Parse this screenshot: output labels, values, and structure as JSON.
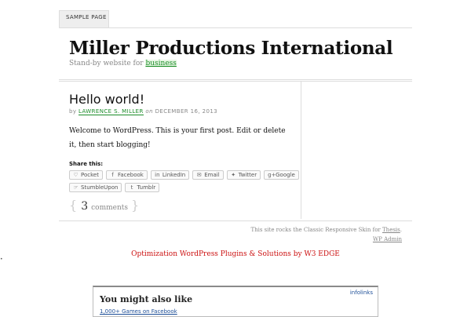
{
  "nav": {
    "sample_page": "Sample Page"
  },
  "header": {
    "site_title": "Miller Productions International",
    "tagline_prefix": "Stand-by website for",
    "tagline_link": "business"
  },
  "post": {
    "title": "Hello world!",
    "by": "by",
    "author": "Lawrence S. Miller",
    "on": "on",
    "date": "December 16, 2013",
    "body": "Welcome to WordPress. This is your first post. Edit or delete it, then start blogging!",
    "share_title": "Share this:",
    "share_row1": [
      {
        "label": "Pocket",
        "icon": "pocket-icon"
      },
      {
        "label": "Facebook",
        "icon": "facebook-icon"
      },
      {
        "label": "LinkedIn",
        "icon": "linkedin-icon"
      },
      {
        "label": "Email",
        "icon": "email-icon"
      },
      {
        "label": "Twitter",
        "icon": "twitter-icon"
      },
      {
        "label": "Google",
        "icon": "google-plus-icon"
      }
    ],
    "share_row2": [
      {
        "label": "StumbleUpon",
        "icon": "stumbleupon-icon"
      },
      {
        "label": "Tumblr",
        "icon": "tumblr-icon"
      }
    ],
    "comment_count": "3",
    "comment_label": "comments"
  },
  "footer": {
    "skin_text": "This site rocks the Classic Responsive Skin for",
    "skin_link": "Thesis",
    "admin_link": "WP Admin"
  },
  "promo": {
    "text": "Optimization WordPress Plugins & Solutions by W3 EDGE"
  },
  "widget": {
    "title": "You might also like",
    "brand": "infolinks",
    "link": "1,000+ Games on Facebook"
  }
}
